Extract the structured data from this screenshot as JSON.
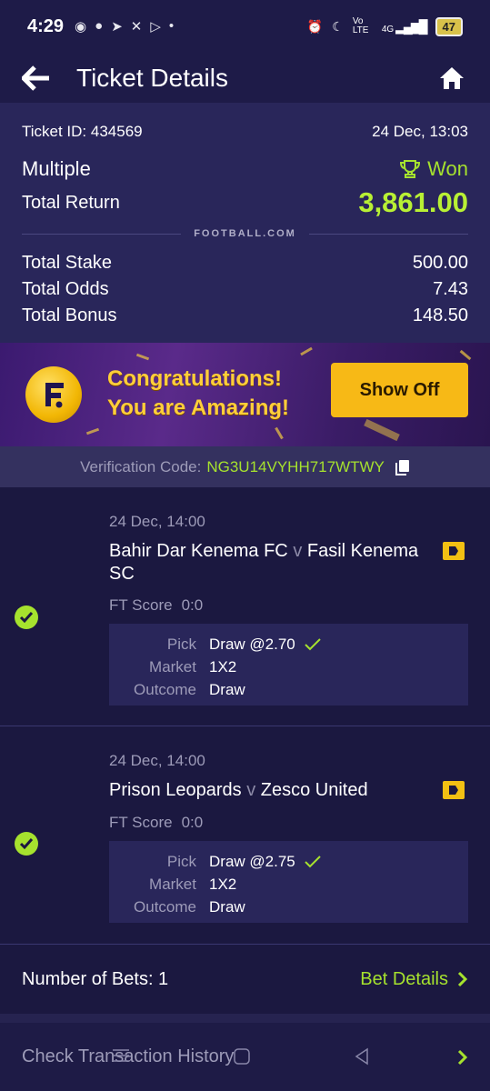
{
  "status_bar": {
    "time": "4:29",
    "network": "4G",
    "volte": "Vo LTE",
    "battery": "47"
  },
  "header": {
    "title": "Ticket Details"
  },
  "summary": {
    "ticket_id": "Ticket ID: 434569",
    "datetime": "24 Dec, 13:03",
    "bet_type": "Multiple",
    "status": "Won",
    "total_return_label": "Total Return",
    "total_return": "3,861.00",
    "brand": "FOOTBALL.COM",
    "stats": [
      {
        "label": "Total Stake",
        "value": "500.00"
      },
      {
        "label": "Total Odds",
        "value": "7.43"
      },
      {
        "label": "Total Bonus",
        "value": "148.50"
      }
    ]
  },
  "banner": {
    "line1": "Congratulations!",
    "line2": "You are Amazing!",
    "button": "Show Off"
  },
  "verification": {
    "label": "Verification Code:",
    "code": "NG3U14VYHH717WTWY"
  },
  "bets": [
    {
      "date": "24 Dec, 14:00",
      "home": "Bahir Dar Kenema FC",
      "sep": "v",
      "away": "Fasil Kenema SC",
      "ft_label": "FT Score",
      "ft_score": "0:0",
      "pick_label": "Pick",
      "pick": "Draw @2.70",
      "market_label": "Market",
      "market": "1X2",
      "outcome_label": "Outcome",
      "outcome": "Draw"
    },
    {
      "date": "24 Dec, 14:00",
      "home": "Prison Leopards",
      "sep": "v",
      "away": "Zesco United",
      "ft_label": "FT Score",
      "ft_score": "0:0",
      "pick_label": "Pick",
      "pick": "Draw @2.75",
      "market_label": "Market",
      "market": "1X2",
      "outcome_label": "Outcome",
      "outcome": "Draw"
    }
  ],
  "footer": {
    "num_bets": "Number of Bets: 1",
    "bet_details": "Bet Details",
    "check_history": "Check Transaction History"
  },
  "colors": {
    "accent_green": "#a6e22e",
    "background": "#1b1840",
    "panel": "#29265a",
    "gold": "#f7b916"
  }
}
